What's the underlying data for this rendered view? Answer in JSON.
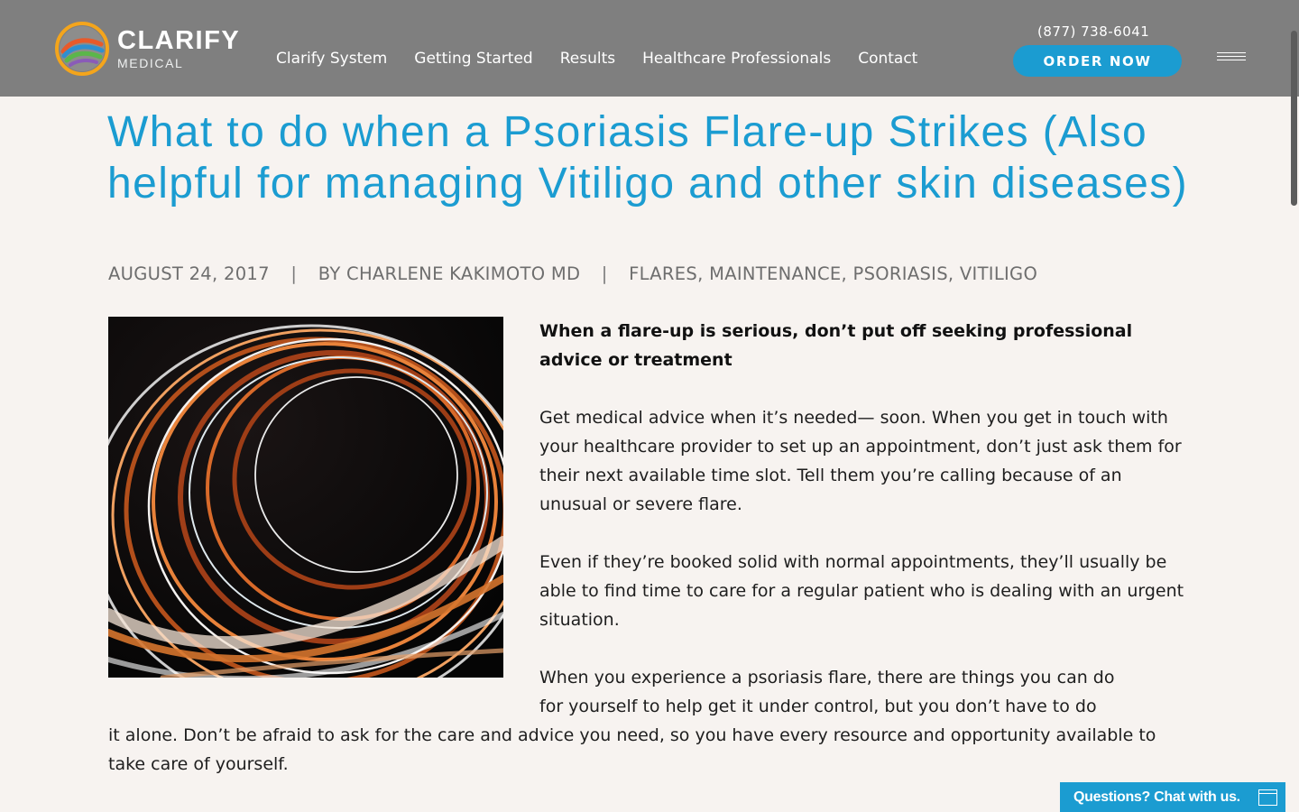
{
  "header": {
    "brand": "CLARIFY",
    "brand_sub": "MEDICAL",
    "nav": [
      {
        "label": "Clarify System"
      },
      {
        "label": "Getting Started"
      },
      {
        "label": "Results"
      },
      {
        "label": "Healthcare Professionals"
      },
      {
        "label": "Contact"
      }
    ],
    "phone": "(877) 738-6041",
    "order_label": "ORDER NOW",
    "menu_icon": "hamburger-icon"
  },
  "article": {
    "title": "What to do when a Psoriasis Flare-up Strikes (Also helpful for managing Vitiligo and other skin diseases)",
    "date": "AUGUST 24, 2017",
    "author": "BY CHARLENE KAKIMOTO MD",
    "categories": "FLARES, MAINTENANCE, PSORIASIS, VITILIGO",
    "separator": "|",
    "lead": "When a flare-up is serious, don’t put off seeking professional advice or treatment",
    "paragraphs": [
      "Get medical advice when it’s needed— soon. When you get in touch with your healthcare provider to set up an appointment, don’t just ask them for their next available time slot. Tell them you’re calling because of an unusual or severe flare.",
      "Even if they’re booked solid with normal appointments, they’ll usually be able to find time to care for a regular patient who is dealing with an urgent situation."
    ],
    "wrap_paragraph_line1": "When you experience a psoriasis flare, there are things you can do",
    "wrap_paragraph_line2": "for yourself to help get it under control, but you don’t have to do",
    "wrap_paragraph_rest": "it alone. Don’t be afraid to ask for the care and advice you need, so you have every resource and opportunity available to take care of yourself."
  },
  "chat": {
    "label": "Questions? Chat with us.",
    "icon": "chat-window-icon"
  },
  "colors": {
    "header_bg": "#7f7f7f",
    "accent": "#1b9cd1",
    "page_bg": "#f7f3f0",
    "meta_text": "#6e6e6e"
  }
}
